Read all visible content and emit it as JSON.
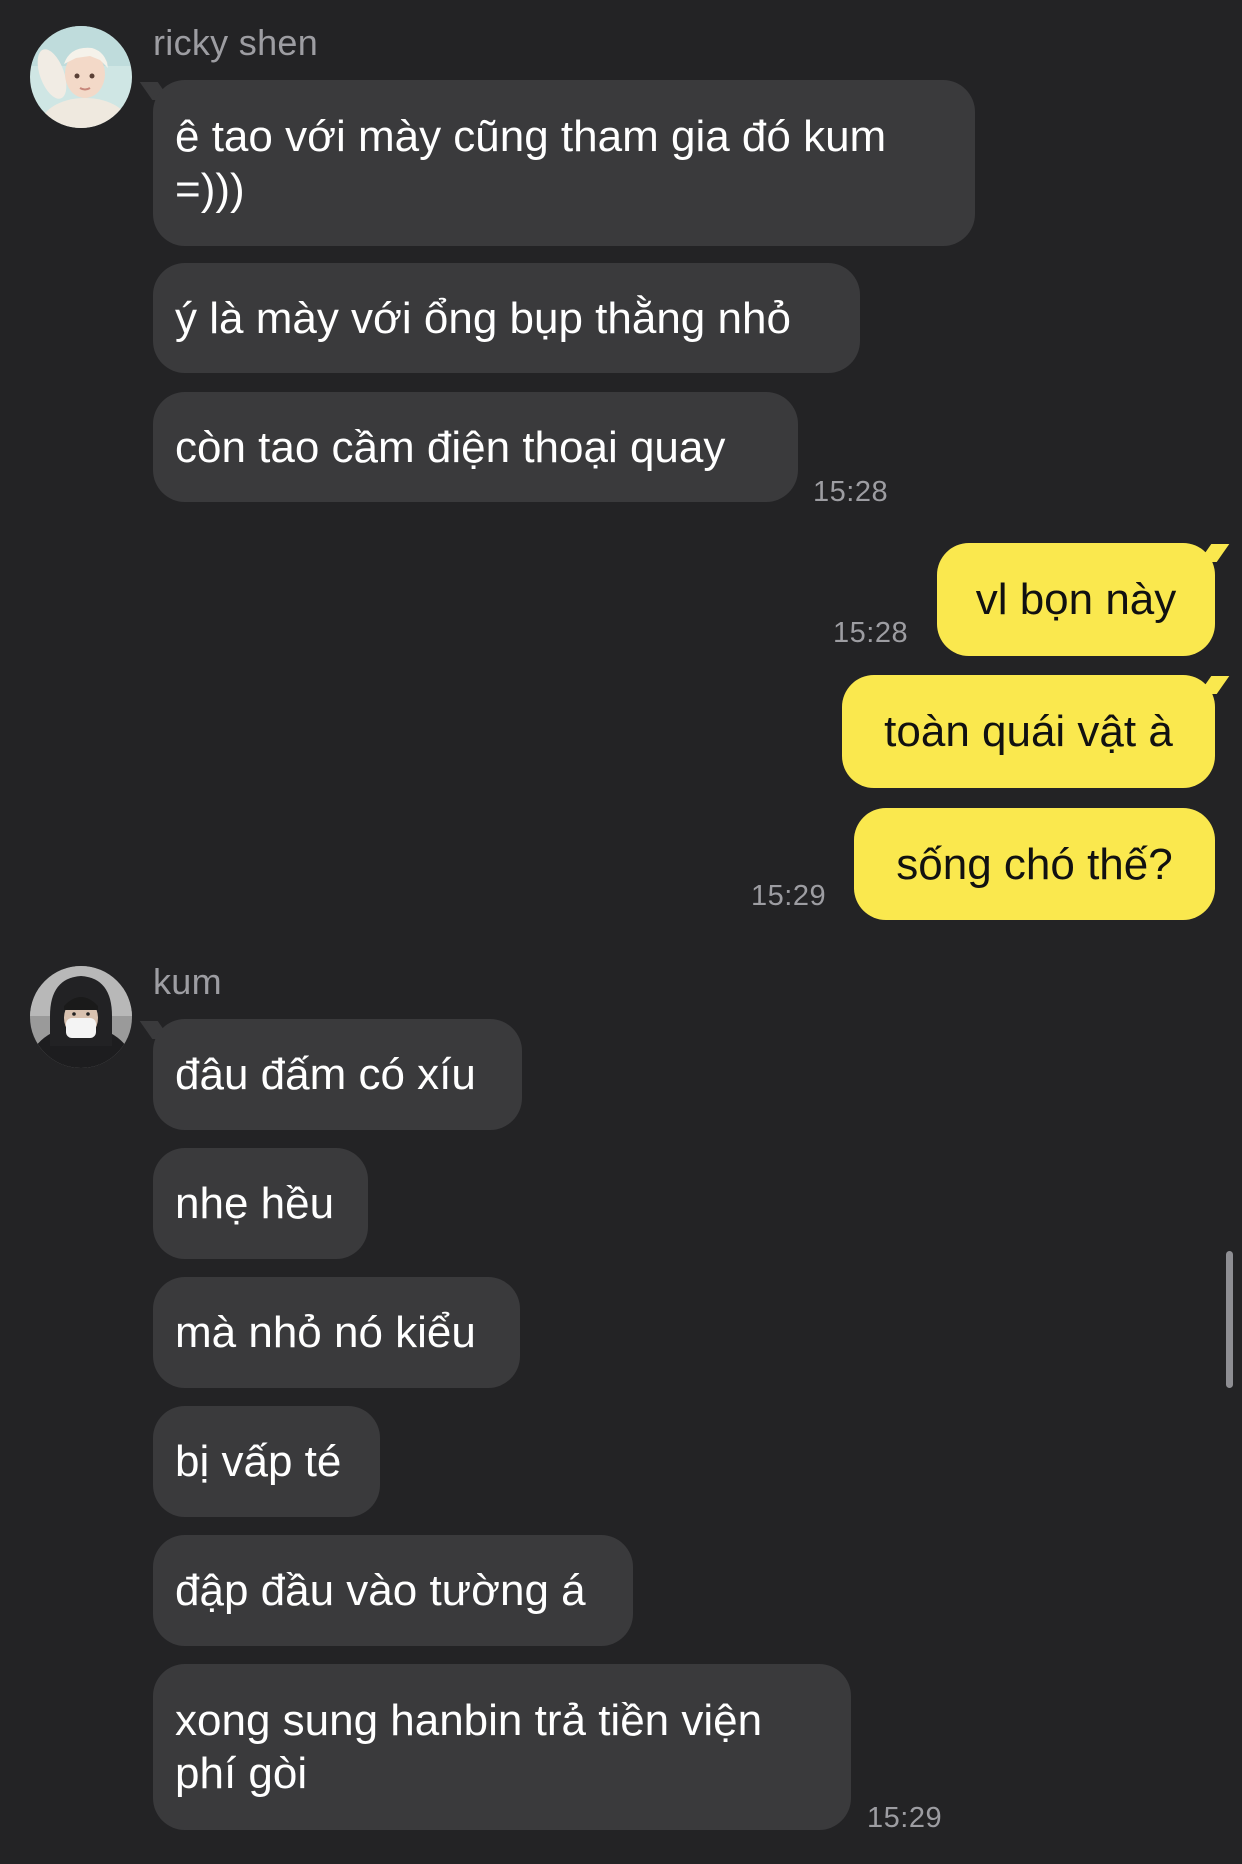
{
  "colors": {
    "background": "#232325",
    "incoming_bubble": "#3a3a3c",
    "outgoing_bubble": "#fae84e",
    "meta_text": "#9d9da2"
  },
  "groups": [
    {
      "sender": "ricky shen",
      "avatar": "avatar-photo",
      "messages": [
        "ê tao với mày cũng tham gia đó kum =)))",
        "ý là mày với ổng bụp thằng nhỏ",
        "còn tao cầm điện thoại quay"
      ],
      "time": "15:28"
    },
    {
      "sender": "kum",
      "avatar": "avatar-photo",
      "messages": [
        "đâu đấm có xíu",
        "nhẹ hều",
        "mà nhỏ nó kiểu",
        "bị vấp té",
        "đập đầu vào tường á",
        "xong sung hanbin trả tiền viện phí gòi"
      ],
      "time": "15:29"
    }
  ],
  "outgoing": {
    "messages": [
      "vl bọn này",
      "toàn quái vật à",
      "sống chó thế?"
    ],
    "times": [
      "15:28",
      "15:29"
    ]
  }
}
